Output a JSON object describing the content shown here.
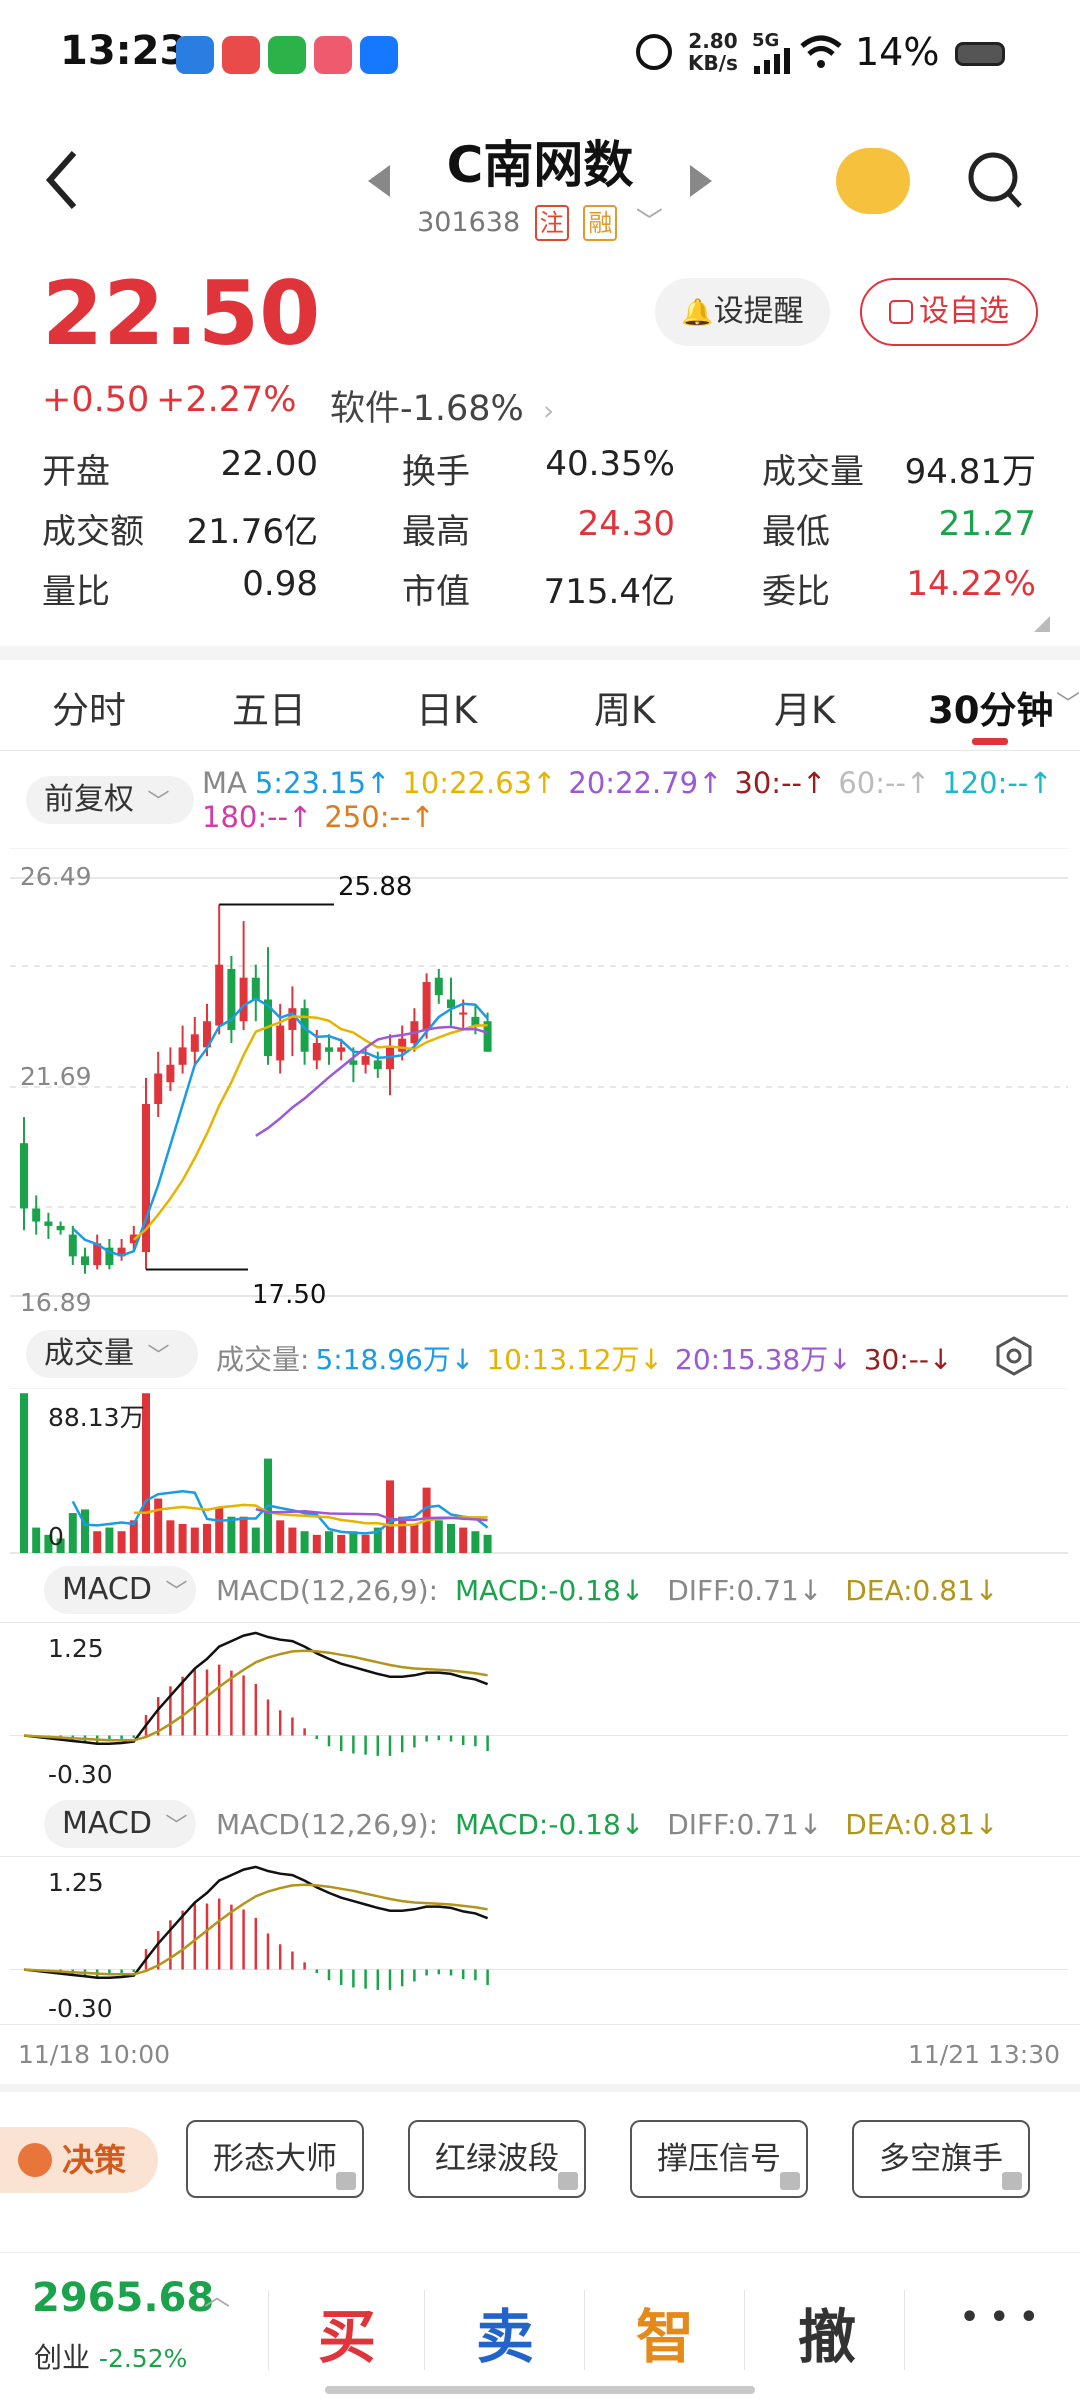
{
  "status_bar": {
    "time": "13:23",
    "net_speed_top": "2.80",
    "net_speed_bottom": "KB/s",
    "signal": "5G",
    "battery": "14%"
  },
  "header": {
    "title": "C南网数",
    "code": "301638",
    "tag1": "注",
    "tag2": "融"
  },
  "quote": {
    "price": "22.50",
    "change": "+0.50",
    "change_pct": "+2.27%",
    "sector": "软件-1.68%",
    "remind_label": "设提醒",
    "add_label": "设自选"
  },
  "stats": [
    {
      "label": "开盘",
      "value": "22.00",
      "color": "normal"
    },
    {
      "label": "换手",
      "value": "40.35%",
      "color": "normal"
    },
    {
      "label": "成交量",
      "value": "94.81万",
      "color": "normal"
    },
    {
      "label": "成交额",
      "value": "21.76亿",
      "color": "normal"
    },
    {
      "label": "最高",
      "value": "24.30",
      "color": "red"
    },
    {
      "label": "最低",
      "value": "21.27",
      "color": "green"
    },
    {
      "label": "量比",
      "value": "0.98",
      "color": "normal"
    },
    {
      "label": "市值",
      "value": "715.4亿",
      "color": "normal"
    },
    {
      "label": "委比",
      "value": "14.22%",
      "color": "red"
    }
  ],
  "tabs": [
    "分时",
    "五日",
    "日K",
    "周K",
    "月K",
    "30分钟"
  ],
  "active_tab": "30分钟",
  "kline": {
    "adjust_label": "前复权",
    "ma_prefix": "MA",
    "ma": [
      {
        "text": "5:23.15↑",
        "color": "#1a9be6"
      },
      {
        "text": "10:22.63↑",
        "color": "#e6b400"
      },
      {
        "text": "20:22.79↑",
        "color": "#9b59d6"
      },
      {
        "text": "30:--↑",
        "color": "#9b1c1c"
      },
      {
        "text": "60:--↑",
        "color": "#bbbbbb"
      },
      {
        "text": "120:--↑",
        "color": "#19b9c9"
      },
      {
        "text": "180:--↑",
        "color": "#d63aa8"
      },
      {
        "text": "250:--↑",
        "color": "#e07a1a"
      }
    ],
    "y_top": "26.49",
    "y_mid": "21.69",
    "y_bottom": "16.89",
    "high_mark": "25.88",
    "low_mark": "17.50"
  },
  "volume": {
    "label": "成交量",
    "prefix": "成交量:",
    "items": [
      {
        "text": "5:18.96万↓",
        "color": "#1a9be6"
      },
      {
        "text": "10:13.12万↓",
        "color": "#e6b400"
      },
      {
        "text": "20:15.38万↓",
        "color": "#9b59d6"
      },
      {
        "text": "30:--↓",
        "color": "#9b1c1c"
      }
    ],
    "max_label": "88.13万",
    "zero_label": "0"
  },
  "macd_panels": [
    {
      "label": "MACD",
      "params": "MACD(12,26,9):",
      "macd": "MACD:-0.18↓",
      "diff": "DIFF:0.71↓",
      "dea": "DEA:0.81↓",
      "top": "1.25",
      "bottom": "-0.30"
    },
    {
      "label": "MACD",
      "params": "MACD(12,26,9):",
      "macd": "MACD:-0.18↓",
      "diff": "DIFF:0.71↓",
      "dea": "DEA:0.81↓",
      "top": "1.25",
      "bottom": "-0.30"
    }
  ],
  "x_axis": {
    "start": "11/18 10:00",
    "end": "11/21 13:30"
  },
  "tools": {
    "decision": "决策",
    "items": [
      "形态大师",
      "红绿波段",
      "撑压信号",
      "多空旗手"
    ]
  },
  "bottom_bar": {
    "index_value": "2965.68",
    "index_name": "创业",
    "index_change": "-2.52%",
    "buy": "买",
    "sell": "卖",
    "smart": "智",
    "cancel": "撤",
    "more": "• • •"
  },
  "colors": {
    "up": "#e0343b",
    "down": "#1aa34a",
    "accent": "#e0343b"
  }
}
